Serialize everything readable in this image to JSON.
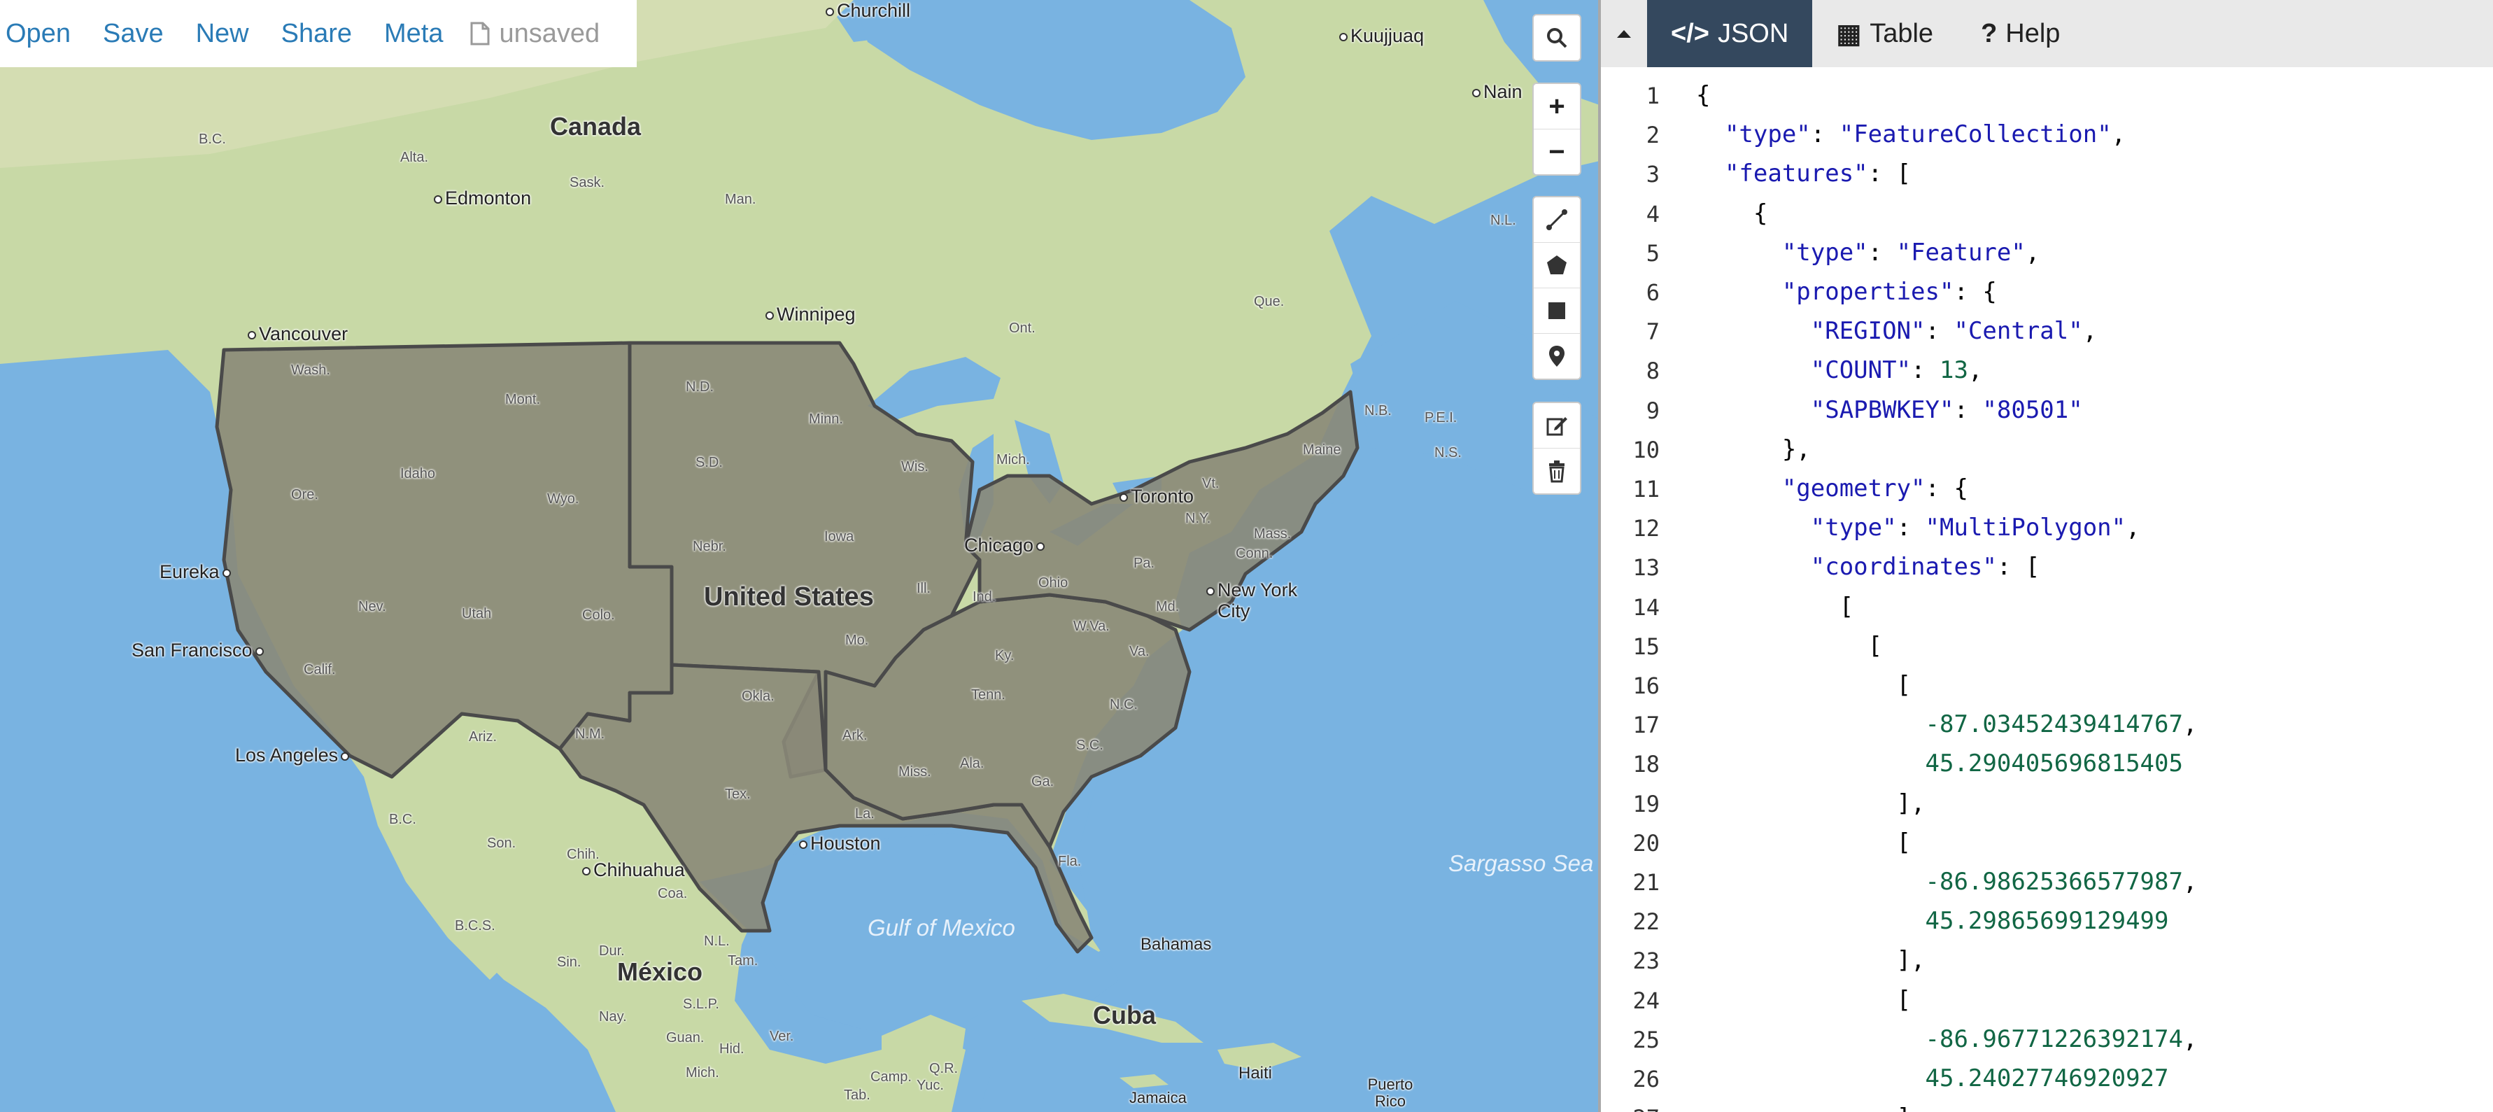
{
  "menu": {
    "items": [
      "Open",
      "Save",
      "New",
      "Share",
      "Meta"
    ],
    "file_status": "unsaved"
  },
  "map": {
    "controls": [
      "search-icon",
      "zoom-in-icon",
      "zoom-out-icon",
      "draw-line-icon",
      "draw-polygon-icon",
      "draw-rectangle-icon",
      "draw-marker-icon",
      "edit-icon",
      "delete-icon"
    ],
    "zoom_in": "+",
    "zoom_out": "−",
    "places": {
      "churchill": "Churchill",
      "kuujjuaq": "Kuujjuaq",
      "nain": "Nain",
      "canada": "Canada",
      "bc": "B.C.",
      "alta": "Alta.",
      "edmonton": "Edmonton",
      "sask": "Sask.",
      "man": "Man.",
      "nl": "N.L.",
      "winnipeg": "Winnipeg",
      "que": "Que.",
      "ont": "Ont.",
      "vancouver": "Vancouver",
      "wash": "Wash.",
      "mont": "Mont.",
      "nd": "N.D.",
      "minn": "Minn.",
      "nb": "N.B.",
      "pei": "P.E.I.",
      "ns": "N.S.",
      "idaho": "Idaho",
      "sd": "S.D.",
      "wis": "Wis.",
      "mich": "Mich.",
      "vt": "Vt.",
      "maine": "Maine",
      "ore": "Ore.",
      "wyo": "Wyo.",
      "toronto": "Toronto",
      "ny": "N.Y.",
      "mass": "Mass.",
      "iowa": "Iowa",
      "nebr": "Nebr.",
      "chicago": "Chicago",
      "pa": "Pa.",
      "conn": "Conn.",
      "eureka": "Eureka",
      "nev": "Nev.",
      "utah": "Utah",
      "colo": "Colo.",
      "united_states": "United States",
      "ill": "Ill.",
      "ind": "Ind.",
      "ohio": "Ohio",
      "new_york_city": "New York City",
      "md": "Md.",
      "wva": "W.Va.",
      "va": "Va.",
      "san_francisco": "San Francisco",
      "calif": "Calif.",
      "mo": "Mo.",
      "ky": "Ky.",
      "okla": "Okla.",
      "tenn": "Tenn.",
      "nc": "N.C.",
      "arz": "Ariz.",
      "nm": "N.M.",
      "los_angeles": "Los Angeles",
      "ark": "Ark.",
      "sc": "S.C.",
      "miss": "Miss.",
      "ala": "Ala.",
      "ga": "Ga.",
      "tex": "Tex.",
      "sargasso_sea": "Sargasso Sea",
      "bc_mx": "B.C.",
      "son": "Son.",
      "chih": "Chih.",
      "chihuahua": "Chihuahua",
      "coa": "Coa.",
      "la": "La.",
      "fla": "Fla.",
      "houston": "Houston",
      "bcs": "B.C.S.",
      "gulf_of_mexico": "Gulf of Mexico",
      "nl_mx": "N.L.",
      "bahamas": "Bahamas",
      "dur": "Dur.",
      "tam": "Tam.",
      "sin": "Sin.",
      "mexico": "México",
      "cuba": "Cuba",
      "nay": "Nay.",
      "slp": "S.L.P.",
      "guan": "Guan.",
      "hid": "Hid.",
      "mich_mx": "Mich.",
      "ver": "Ver.",
      "yuc": "Yuc.",
      "qr": "Q.R.",
      "camp": "Camp.",
      "tab": "Tab.",
      "haiti": "Haiti",
      "puerto_rico": "Puerto Rico",
      "jamaica": "Jamaica"
    }
  },
  "panel": {
    "tabs": [
      {
        "icon": "</>",
        "label": "JSON"
      },
      {
        "icon": "▦",
        "label": "Table"
      },
      {
        "icon": "?",
        "label": "Help"
      }
    ],
    "code_lines": [
      [
        {
          "t": "p",
          "v": "{"
        }
      ],
      [
        {
          "t": "p",
          "v": "  "
        },
        {
          "t": "k",
          "v": "\"type\""
        },
        {
          "t": "p",
          "v": ": "
        },
        {
          "t": "s",
          "v": "\"FeatureCollection\""
        },
        {
          "t": "p",
          "v": ","
        }
      ],
      [
        {
          "t": "p",
          "v": "  "
        },
        {
          "t": "k",
          "v": "\"features\""
        },
        {
          "t": "p",
          "v": ": ["
        }
      ],
      [
        {
          "t": "p",
          "v": "    {"
        }
      ],
      [
        {
          "t": "p",
          "v": "      "
        },
        {
          "t": "k",
          "v": "\"type\""
        },
        {
          "t": "p",
          "v": ": "
        },
        {
          "t": "s",
          "v": "\"Feature\""
        },
        {
          "t": "p",
          "v": ","
        }
      ],
      [
        {
          "t": "p",
          "v": "      "
        },
        {
          "t": "k",
          "v": "\"properties\""
        },
        {
          "t": "p",
          "v": ": {"
        }
      ],
      [
        {
          "t": "p",
          "v": "        "
        },
        {
          "t": "k",
          "v": "\"REGION\""
        },
        {
          "t": "p",
          "v": ": "
        },
        {
          "t": "s",
          "v": "\"Central\""
        },
        {
          "t": "p",
          "v": ","
        }
      ],
      [
        {
          "t": "p",
          "v": "        "
        },
        {
          "t": "k",
          "v": "\"COUNT\""
        },
        {
          "t": "p",
          "v": ": "
        },
        {
          "t": "n",
          "v": "13"
        },
        {
          "t": "p",
          "v": ","
        }
      ],
      [
        {
          "t": "p",
          "v": "        "
        },
        {
          "t": "k",
          "v": "\"SAPBWKEY\""
        },
        {
          "t": "p",
          "v": ": "
        },
        {
          "t": "s",
          "v": "\"80501\""
        }
      ],
      [
        {
          "t": "p",
          "v": "      },"
        }
      ],
      [
        {
          "t": "p",
          "v": "      "
        },
        {
          "t": "k",
          "v": "\"geometry\""
        },
        {
          "t": "p",
          "v": ": {"
        }
      ],
      [
        {
          "t": "p",
          "v": "        "
        },
        {
          "t": "k",
          "v": "\"type\""
        },
        {
          "t": "p",
          "v": ": "
        },
        {
          "t": "s",
          "v": "\"MultiPolygon\""
        },
        {
          "t": "p",
          "v": ","
        }
      ],
      [
        {
          "t": "p",
          "v": "        "
        },
        {
          "t": "k",
          "v": "\"coordinates\""
        },
        {
          "t": "p",
          "v": ": ["
        }
      ],
      [
        {
          "t": "p",
          "v": "          ["
        }
      ],
      [
        {
          "t": "p",
          "v": "            ["
        }
      ],
      [
        {
          "t": "p",
          "v": "              ["
        }
      ],
      [
        {
          "t": "p",
          "v": "                "
        },
        {
          "t": "n",
          "v": "-87.03452439414767"
        },
        {
          "t": "p",
          "v": ","
        }
      ],
      [
        {
          "t": "p",
          "v": "                "
        },
        {
          "t": "n",
          "v": "45.290405696815405"
        }
      ],
      [
        {
          "t": "p",
          "v": "              ],"
        }
      ],
      [
        {
          "t": "p",
          "v": "              ["
        }
      ],
      [
        {
          "t": "p",
          "v": "                "
        },
        {
          "t": "n",
          "v": "-86.98625366577987"
        },
        {
          "t": "p",
          "v": ","
        }
      ],
      [
        {
          "t": "p",
          "v": "                "
        },
        {
          "t": "n",
          "v": "45.29865699129499"
        }
      ],
      [
        {
          "t": "p",
          "v": "              ],"
        }
      ],
      [
        {
          "t": "p",
          "v": "              ["
        }
      ],
      [
        {
          "t": "p",
          "v": "                "
        },
        {
          "t": "n",
          "v": "-86.96771226392174"
        },
        {
          "t": "p",
          "v": ","
        }
      ],
      [
        {
          "t": "p",
          "v": "                "
        },
        {
          "t": "n",
          "v": "45.24027746920927"
        }
      ],
      [
        {
          "t": "p",
          "v": "              ]"
        }
      ]
    ]
  },
  "colors": {
    "water": "#79b3e1",
    "land": "#c7d8a8",
    "us_fill": "#8a8a7a",
    "link": "#2a7bb6",
    "tab_active": "#34485e"
  }
}
